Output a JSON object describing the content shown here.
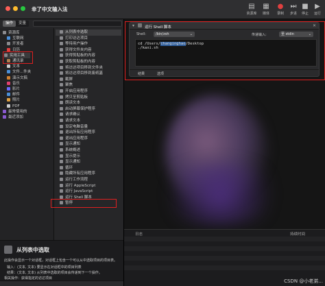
{
  "window": {
    "title": "幸了中文输入法"
  },
  "toolbar": [
    {
      "label": "资源库",
      "icon": "library-icon"
    },
    {
      "label": "媒体",
      "icon": "media-icon"
    },
    {
      "label": "录制",
      "icon": "record-icon"
    },
    {
      "label": "步进",
      "icon": "step-icon"
    },
    {
      "label": "停止",
      "icon": "stop-icon"
    },
    {
      "label": "运行",
      "icon": "run-icon"
    }
  ],
  "left": {
    "tabs": [
      "操作",
      "变量"
    ],
    "library": [
      {
        "label": "资源库",
        "color": "#8a8a8e",
        "indent": 0
      },
      {
        "label": "互联网",
        "color": "#4a8fd9",
        "indent": 1
      },
      {
        "label": "开发者",
        "color": "#8a8a8e",
        "indent": 1
      },
      {
        "label": "日历",
        "color": "#e04040",
        "indent": 1
      },
      {
        "label": "实用工具",
        "color": "#8a8a8e",
        "indent": 1
      },
      {
        "label": "通讯录",
        "color": "#b08050",
        "indent": 1
      },
      {
        "label": "文本",
        "color": "#cccccc",
        "indent": 1
      },
      {
        "label": "文件...件夹",
        "color": "#4a8fd9",
        "indent": 1
      },
      {
        "label": "演示文稿",
        "color": "#d08030",
        "indent": 1
      },
      {
        "label": "音乐",
        "color": "#e04070",
        "indent": 1
      },
      {
        "label": "影片",
        "color": "#6a6aff",
        "indent": 1
      },
      {
        "label": "邮件",
        "color": "#4a8fd9",
        "indent": 1
      },
      {
        "label": "照片",
        "color": "#e0a040",
        "indent": 1
      },
      {
        "label": "PDF",
        "color": "#cccccc",
        "indent": 1
      },
      {
        "label": "最常使用的",
        "color": "#8a5ad0",
        "indent": 0
      },
      {
        "label": "最近添加",
        "color": "#8a5ad0",
        "indent": 0
      }
    ],
    "actions": [
      "从列表中选取",
      "打印访达项目",
      "等待用户操作",
      "获得文件夹内容",
      "获得剪贴板的内容",
      "获取剪贴板的内容",
      "将访达项目移到文件夹",
      "将访达项目移到废纸篓",
      "截屏",
      "聚焦",
      "开启应用程序",
      "拷贝至剪贴板",
      "朗读文本",
      "启动屏幕保护程序",
      "请求确认",
      "请求文本",
      "设定电脑音量",
      "退出所有应用程序",
      "退出应用程序",
      "显示通知",
      "系统概述",
      "显示提示",
      "显示通知",
      "循环",
      "隐藏所有应用程序",
      "运行工作流程",
      "运行 AppleScript",
      "运行 JavaScript",
      "运行 Shell 脚本",
      "暂停"
    ],
    "description": {
      "title": "从列表中选取",
      "text": "此操作会显示一个对话框，对话框上包含一个可以从中选取项目的项目表。",
      "input_label": "输入：",
      "input_text": "(文本, 文本) 要显示在对话框中的项目列表",
      "result_label": "结果：",
      "result_text": "(文本, 文本) 从列表中选取的项目会传递到下一个操作。",
      "related_label": "相关操作：",
      "related_text": "获得指定的访达项目"
    }
  },
  "workflow": {
    "card": {
      "title": "运行 Shell 脚本",
      "shell_label": "Shell:",
      "shell_value": "/bin/zsh",
      "input_label": "传递输入:",
      "input_value": "至 stdin",
      "code_line1_pre": "cd /Users/",
      "code_line1_sel": "changinghao",
      "code_line1_post": "/Desktop",
      "code_line2": "./kaxi.sh",
      "tabs": [
        "结果",
        "选项"
      ]
    },
    "log": {
      "col_log": "日志",
      "col_duration": "持续时间"
    }
  },
  "watermark": "CSDN @小老弟..."
}
